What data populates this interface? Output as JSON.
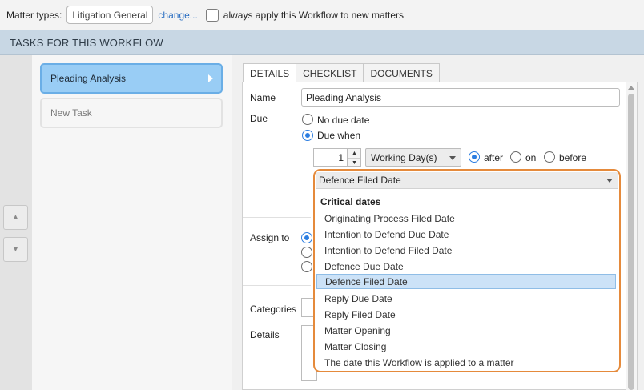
{
  "top": {
    "matter_types_label": "Matter types:",
    "matter_type_value": "Litigation General",
    "change_link": "change...",
    "always_apply_label": "always apply this Workflow to new matters"
  },
  "section": {
    "title": "TASKS FOR THIS WORKFLOW"
  },
  "tasks": [
    {
      "label": "Pleading Analysis"
    },
    {
      "label": "New Task"
    }
  ],
  "tabs": [
    "DETAILS",
    "CHECKLIST",
    "DOCUMENTS"
  ],
  "details": {
    "name_label": "Name",
    "name_value": "Pleading Analysis",
    "due_label": "Due",
    "no_due_date": "No due date",
    "due_when": "Due when",
    "quantity": "1",
    "unit": "Working Day(s)",
    "after": "after",
    "on": "on",
    "before": "before",
    "assign_to_label": "Assign to",
    "categories_label": "Categories",
    "details_label": "Details"
  },
  "dropdown": {
    "selected": "Defence Filed Date",
    "group_header": "Critical dates",
    "options": [
      "Originating Process Filed Date",
      "Intention to Defend Due Date",
      "Intention to Defend Filed Date",
      "Defence Due Date",
      "Defence Filed Date",
      "Reply Due Date",
      "Reply Filed Date",
      "Matter Opening",
      "Matter Closing",
      "The date this Workflow is applied to a matter"
    ]
  },
  "colors": {
    "accent": "#2b7de1",
    "active_task": "#99cdf5",
    "highlight_outline": "#e58a3b",
    "section_header": "#c8d7e4"
  }
}
